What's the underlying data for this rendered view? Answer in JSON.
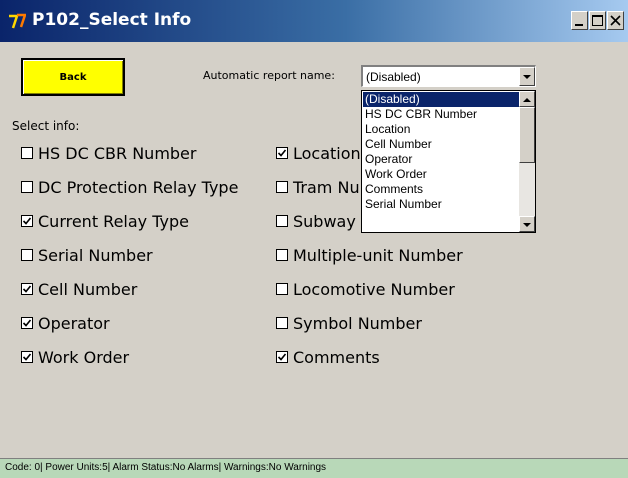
{
  "window": {
    "title": "P102_Select Info"
  },
  "toolbar": {
    "back_label": "Back",
    "auto_report_label": "Automatic report name:",
    "auto_report_value": "(Disabled)"
  },
  "dropdown": {
    "options": [
      "(Disabled)",
      "HS DC CBR Number",
      "Location",
      "Cell Number",
      "Operator",
      "Work Order",
      "Comments",
      "Serial Number"
    ],
    "selected_index": 0
  },
  "select_info_label": "Select info:",
  "checkboxes_left": [
    {
      "label": "HS DC CBR Number",
      "checked": false
    },
    {
      "label": "DC Protection Relay Type",
      "checked": false
    },
    {
      "label": "Current Relay Type",
      "checked": true
    },
    {
      "label": "Serial Number",
      "checked": false
    },
    {
      "label": "Cell Number",
      "checked": true
    },
    {
      "label": "Operator",
      "checked": true
    },
    {
      "label": "Work Order",
      "checked": true
    }
  ],
  "checkboxes_right": [
    {
      "label": "Location",
      "checked": true
    },
    {
      "label": "Tram Nu",
      "checked": false
    },
    {
      "label": "Subway",
      "checked": false
    },
    {
      "label": "Multiple-unit Number",
      "checked": false
    },
    {
      "label": "Locomotive Number",
      "checked": false
    },
    {
      "label": "Symbol Number",
      "checked": false
    },
    {
      "label": "Comments",
      "checked": true
    }
  ],
  "status_bar": "Code: 0| Power Units:5| Alarm Status:No Alarms| Warnings:No Warnings",
  "colors": {
    "back_button": "#ffff00",
    "status_bar": "#b8d8b8",
    "selection": "#0a246a"
  }
}
